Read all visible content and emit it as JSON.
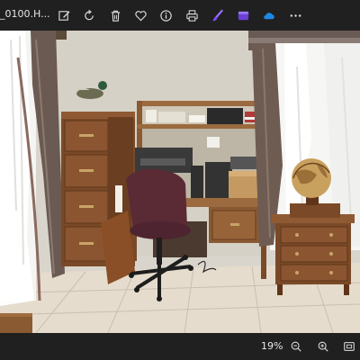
{
  "titlebar": {
    "file_name": "_0100.H..."
  },
  "toolbar": {
    "buttons": [
      {
        "name": "edit-image-button",
        "icon": "edit-icon"
      },
      {
        "name": "rotate-button",
        "icon": "rotate-icon"
      },
      {
        "name": "delete-button",
        "icon": "trash-icon"
      },
      {
        "name": "favorite-button",
        "icon": "heart-icon"
      },
      {
        "name": "file-info-button",
        "icon": "info-icon"
      },
      {
        "name": "print-button",
        "icon": "printer-icon"
      },
      {
        "name": "designer-button",
        "icon": "paint-brush-icon"
      },
      {
        "name": "clipchamp-button",
        "icon": "clipchamp-icon"
      },
      {
        "name": "onedrive-button",
        "icon": "cloud-icon"
      },
      {
        "name": "more-options-button",
        "icon": "more-horizontal-icon"
      }
    ]
  },
  "photo": {
    "subject": "home-office-scene"
  },
  "statusbar": {
    "zoom_level": "19%",
    "buttons": [
      {
        "name": "zoom-out-button",
        "icon": "zoom-out-icon"
      },
      {
        "name": "zoom-in-button",
        "icon": "zoom-in-icon"
      },
      {
        "name": "fit-to-window-button",
        "icon": "fit-window-icon"
      }
    ]
  },
  "colors": {
    "chrome": "#202020",
    "accent_purple": "#6b3fd6",
    "accent_blue": "#1e88e5",
    "wall": "#d9d5cc",
    "wood": "#8a5a32",
    "floor": "#e6dccd"
  }
}
